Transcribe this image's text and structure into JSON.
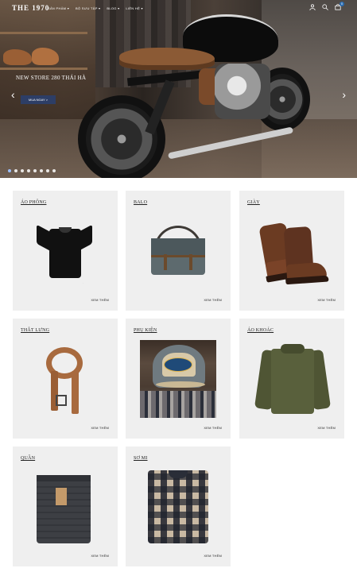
{
  "header": {
    "logo": "THE 1970",
    "nav": [
      "SẢN PHẨM ▾",
      "BỘ SƯU TẬP ▾",
      "BLOG ▾",
      "LIÊN HỆ ▾"
    ],
    "cart_count": "0",
    "icons": [
      "user-icon",
      "search-icon",
      "cart-icon"
    ]
  },
  "hero": {
    "headline": "NEW STORE 280 THÁI HÀ",
    "button": "MUA NGAY >",
    "prev": "‹",
    "next": "›",
    "slides": 8,
    "active_slide": 1
  },
  "categories": [
    {
      "title": "ÁO PHÔNG",
      "more": "XEM THÊM",
      "product": "t-shirt"
    },
    {
      "title": "BALO",
      "more": "XEM THÊM",
      "product": "messenger-bag"
    },
    {
      "title": "GIÀY",
      "more": "XEM THÊM",
      "product": "boots"
    },
    {
      "title": "THẮT LƯNG",
      "more": "XEM THÊM",
      "product": "belt"
    },
    {
      "title": "PHỤ KIỆN",
      "more": "XEM THÊM",
      "product": "cap"
    },
    {
      "title": "ÁO KHOÁC",
      "more": "XEM THÊM",
      "product": "jacket"
    },
    {
      "title": "QUẦN",
      "more": "XEM THÊM",
      "product": "jeans"
    },
    {
      "title": "SƠ MI",
      "more": "XEM THÊM",
      "product": "plaid-shirt"
    }
  ]
}
